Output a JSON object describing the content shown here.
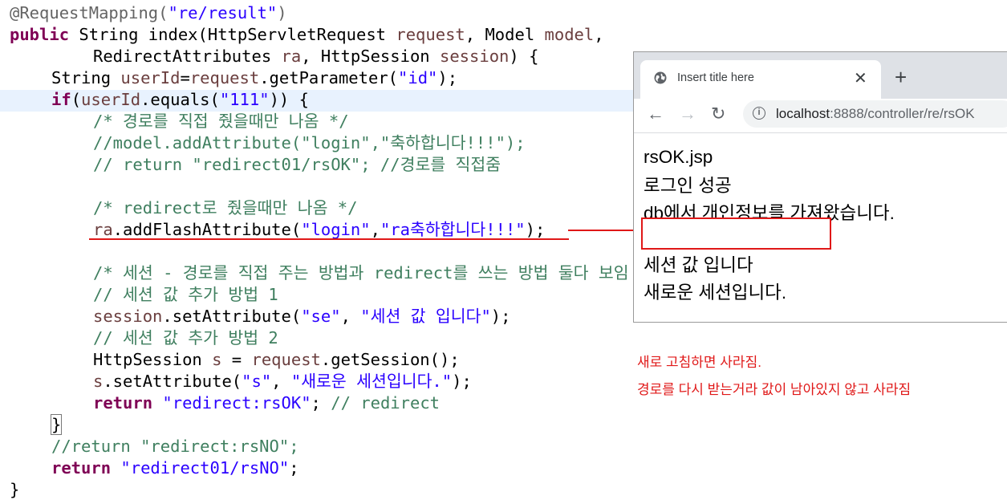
{
  "code": {
    "l1_ann": "@RequestMapping(",
    "l1_str": "\"re/result\"",
    "l1_end": ")",
    "l2_kw": "public",
    "l2_text": " String index(HttpServletRequest ",
    "l2_var1": "request",
    "l2_mid": ", Model ",
    "l2_var2": "model",
    "l2_end": ",",
    "l3_text": "RedirectAttributes ",
    "l3_var1": "ra",
    "l3_mid": ", HttpSession ",
    "l3_var2": "session",
    "l3_end": ") {",
    "l4_text": "String ",
    "l4_var1": "userId",
    "l4_mid": "=",
    "l4_var2": "request",
    "l4_call": ".getParameter(",
    "l4_str": "\"id\"",
    "l4_end": ");",
    "l5_kw": "if",
    "l5_open": "(",
    "l5_var": "userId",
    "l5_call": ".equals(",
    "l5_str": "\"111\"",
    "l5_end": ")) {",
    "l6": "/* 경로를 직접 줬을때만 나옴 */",
    "l7": "//model.addAttribute(\"login\",\"축하합니다!!!\");",
    "l8": "// return \"redirect01/rsOK\"; //경로를 직접줌",
    "l9": "/* redirect로 줬을때만 나옴 */",
    "l10_var": "ra",
    "l10_call": ".addFlashAttribute(",
    "l10_str1": "\"login\"",
    "l10_comma": ",",
    "l10_str2": "\"ra축하합니다!!!\"",
    "l10_end": ");",
    "l11": "/* 세션 - 경로를 직접 주는 방법과 redirect를 쓰는 방법 둘다 보임 */",
    "l12": "// 세션 값 추가 방법 1",
    "l13_var": "session",
    "l13_call": ".setAttribute(",
    "l13_str1": "\"se\"",
    "l13_comma": ", ",
    "l13_str2": "\"세션 값 입니다\"",
    "l13_end": ");",
    "l14": "// 세션 값 추가 방법 2",
    "l15_text": "HttpSession ",
    "l15_var1": "s",
    "l15_mid": " = ",
    "l15_var2": "request",
    "l15_end": ".getSession();",
    "l16_var": "s",
    "l16_call": ".setAttribute(",
    "l16_str1": "\"s\"",
    "l16_comma": ", ",
    "l16_str2": "\"새로운 세션입니다.\"",
    "l16_end": ");",
    "l17_kw": "return",
    "l17_sp": " ",
    "l17_str": "\"redirect:rsOK\"",
    "l17_semi": "; ",
    "l17_cm": "// redirect",
    "l18": "}",
    "l19": "//return \"redirect:rsNO\";",
    "l20_kw": "return",
    "l20_sp": " ",
    "l20_str": "\"redirect01/rsNO\"",
    "l20_end": ";",
    "l21": "}"
  },
  "browser": {
    "tab_title": "Insert title here",
    "tab_close": "✕",
    "new_tab": "+",
    "back": "←",
    "forward": "→",
    "reload": "↻",
    "info": "i",
    "url_host": "localhost",
    "url_rest": ":8888/controller/re/rsOK",
    "page_lines": [
      "rsOK.jsp",
      "로그인 성공",
      "db에서 개인정보를 가져왔습니다.",
      "세션 값 입니다",
      "새로운 세션입니다."
    ]
  },
  "notes": [
    "새로 고침하면 사라짐.",
    "경로를 다시 받는거라 값이 남아있지 않고 사라짐"
  ],
  "colors": {
    "keyword": "#7f0055",
    "string": "#2a00ff",
    "comment": "#3f7f5f",
    "variable": "#6a3e3e",
    "annotation_red": "#e01818"
  }
}
